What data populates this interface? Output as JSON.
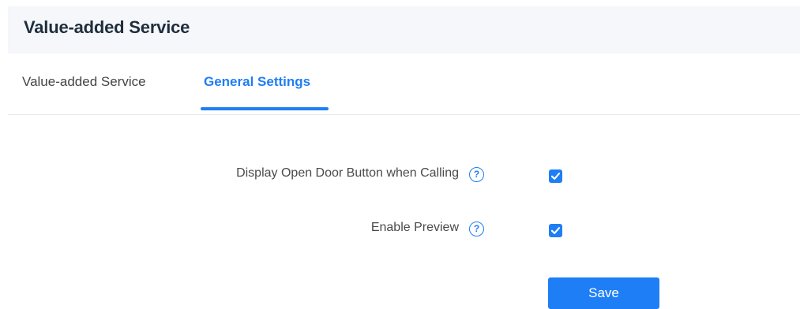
{
  "header": {
    "title": "Value-added Service"
  },
  "tabs": [
    {
      "label": "Value-added Service",
      "active": false
    },
    {
      "label": "General Settings",
      "active": true
    }
  ],
  "settings": [
    {
      "label": "Display Open Door Button when Calling",
      "help_icon": "question-circle-icon",
      "checked": true
    },
    {
      "label": "Enable Preview",
      "help_icon": "question-circle-icon",
      "checked": true
    }
  ],
  "actions": {
    "save_label": "Save"
  },
  "colors": {
    "accent": "#1e7ef5",
    "header_bg": "#f5f7fa",
    "divider": "#e4e7ed"
  }
}
